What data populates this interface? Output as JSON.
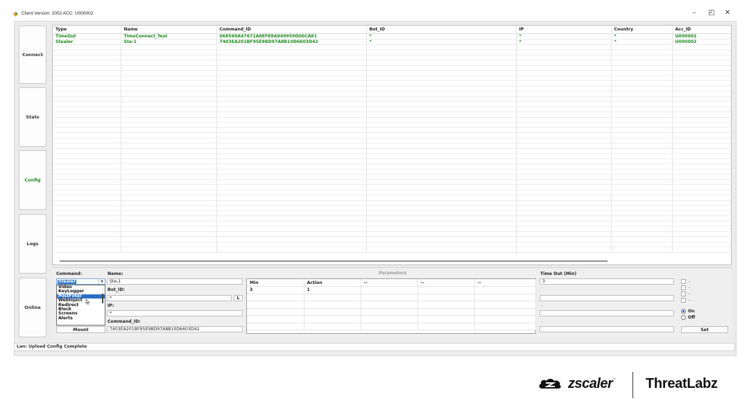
{
  "window": {
    "title": "Client Version: 2052 ACC: U000002",
    "min_glyph": "–",
    "restore_glyph": "◰",
    "close_glyph": "✕"
  },
  "nav": [
    {
      "label": "Connect",
      "active": false
    },
    {
      "label": "Stats",
      "active": false
    },
    {
      "label": "Config",
      "active": true
    },
    {
      "label": "Logs",
      "active": false
    },
    {
      "label": "Online",
      "active": false
    }
  ],
  "grid": {
    "columns": [
      "Type",
      "Name",
      "Command_ID",
      "Bot_ID",
      "IP",
      "Country",
      "Acc_ID"
    ],
    "rows": [
      [
        "TimeOut",
        "TimeConnect_Test",
        "068569A47671A8EFE8A949959D00CA81",
        "*",
        "*",
        "*",
        "U000002"
      ],
      [
        "Stealer",
        "Ste-1",
        "7403EA201BF95E9BD97A8B10D6603D42",
        "*",
        "*",
        "*",
        "U000002"
      ]
    ]
  },
  "form": {
    "command_label": "Command:",
    "command_value": "Stealer",
    "command_options": [
      "Video",
      "KeyLogger",
      "PostFilter",
      "WebInject",
      "Redirect",
      "Block",
      "Screens",
      "Alerts"
    ],
    "selected_option": "PostFilter",
    "name_label": "Name:",
    "name_value": "Ste-1",
    "bot_id_label": "Bot_ID:",
    "bot_id_value": "*",
    "bot_id_button": "L",
    "ip_label": "IP:",
    "ip_value": "*",
    "command_id_label": "Command_ID:",
    "command_id_value": "7403EA201BF95E9BD97A8B10D6603D42",
    "mount_button": "Mount"
  },
  "parameters": {
    "title": "Parameters",
    "header": [
      "Min",
      "Action",
      "--",
      "--",
      "--"
    ],
    "row": [
      "3",
      "1",
      "",
      "",
      ""
    ]
  },
  "timeout": {
    "label": "Time Out (Min)",
    "value": "3",
    "hint1": "--",
    "hint2": "--",
    "hint3": "--"
  },
  "options": {
    "checkboxes": [
      "--",
      "--",
      "--",
      "--"
    ],
    "on_label": "On",
    "off_label": "Off",
    "selected": "On",
    "set_button": "Set"
  },
  "status": "Lan: Upload Config Complete",
  "branding": {
    "zscaler": "zscaler",
    "trademark": "™",
    "threatlabz": "ThreatLabz"
  }
}
